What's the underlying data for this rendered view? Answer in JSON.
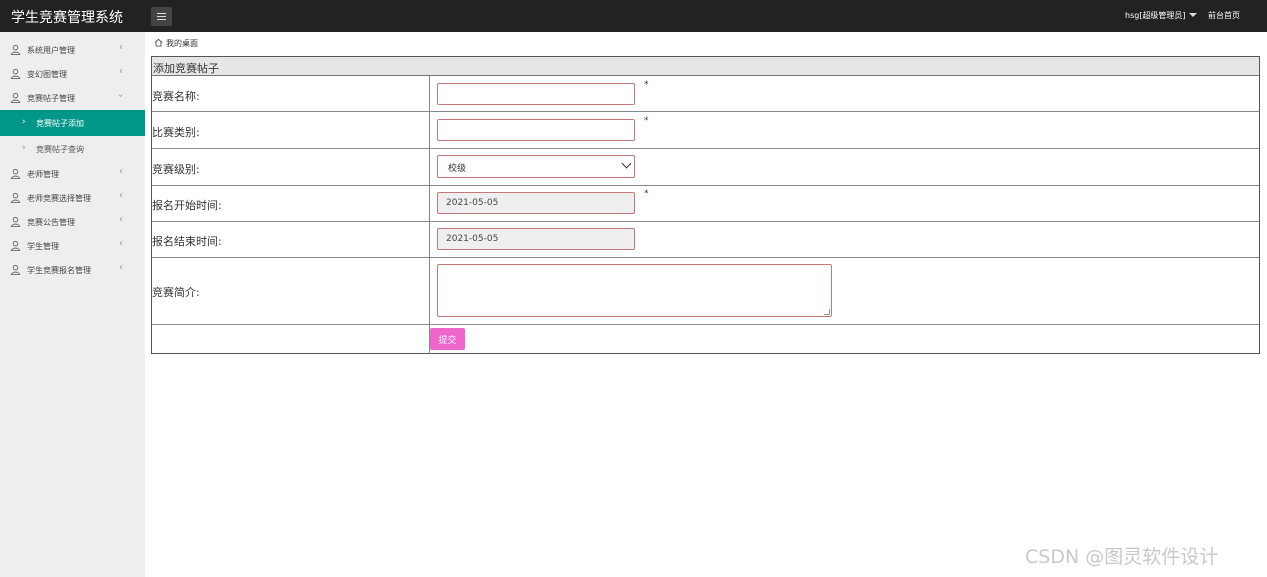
{
  "app": {
    "title": "学生竞赛管理系统",
    "user_label": "hsg[超级管理员]",
    "front_link": "前台首页"
  },
  "sidebar": {
    "items": [
      {
        "label": "系统用户管理"
      },
      {
        "label": "变幻图管理"
      },
      {
        "label": "竞赛帖子管理"
      },
      {
        "label": "老师管理"
      },
      {
        "label": "老师竞赛选择管理"
      },
      {
        "label": "竞赛公告管理"
      },
      {
        "label": "学生管理"
      },
      {
        "label": "学生竞赛报名管理"
      }
    ],
    "subitems": [
      {
        "label": "竞赛帖子添加",
        "active": true
      },
      {
        "label": "竞赛帖子查询",
        "active": false
      }
    ],
    "active_color": "#009688"
  },
  "breadcrumb": "我的桌面",
  "form": {
    "header": "添加竞赛帖子",
    "fields": {
      "name": {
        "label": "竞赛名称:",
        "value": "",
        "required": "*"
      },
      "category": {
        "label": "比赛类别:",
        "value": "",
        "required": "*"
      },
      "level": {
        "label": "竞赛级别:",
        "selected": "校级"
      },
      "start": {
        "label": "报名开始时间:",
        "value": "2021-05-05",
        "required": "*"
      },
      "end": {
        "label": "报名结束时间:",
        "value": "2021-05-05"
      },
      "intro": {
        "label": "竞赛简介:",
        "value": ""
      }
    },
    "submit_label": "提交",
    "submit_color": "#ee66cc"
  },
  "watermark": "CSDN @图灵软件设计"
}
